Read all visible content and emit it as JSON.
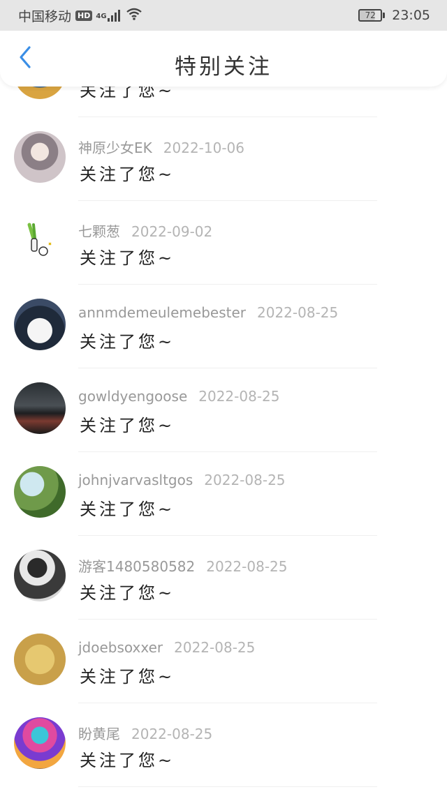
{
  "status_bar": {
    "carrier": "中国移动",
    "hd": "HD",
    "network": "4G",
    "battery": "72",
    "time": "23:05"
  },
  "nav": {
    "title": "特别关注"
  },
  "colors": {
    "accent": "#3a8ee6"
  },
  "items": [
    {
      "name": "",
      "date": "",
      "message": "关注了您~"
    },
    {
      "name": "神原少女EK",
      "date": "2022-10-06",
      "message": "关注了您~"
    },
    {
      "name": "七颗葱",
      "date": "2022-09-02",
      "message": "关注了您~"
    },
    {
      "name": "annmdemeulemebester",
      "date": "2022-08-25",
      "message": "关注了您~"
    },
    {
      "name": "gowldyengoose",
      "date": "2022-08-25",
      "message": "关注了您~"
    },
    {
      "name": "johnjvarvasltgos",
      "date": "2022-08-25",
      "message": "关注了您~"
    },
    {
      "name": "游客1480580582",
      "date": "2022-08-25",
      "message": "关注了您~"
    },
    {
      "name": "jdoebsoxxer",
      "date": "2022-08-25",
      "message": "关注了您~"
    },
    {
      "name": "盼黄尾",
      "date": "2022-08-25",
      "message": "关注了您~"
    }
  ]
}
